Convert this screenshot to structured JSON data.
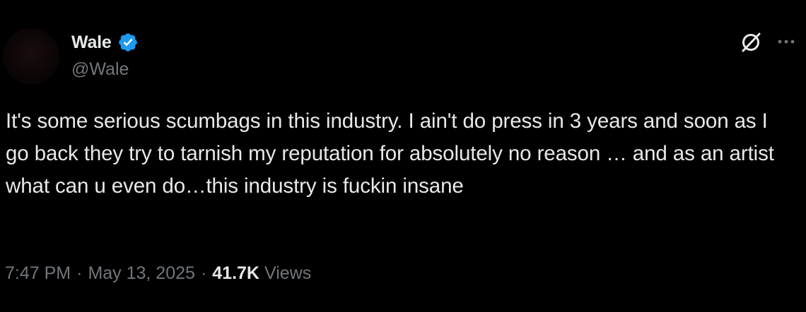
{
  "author": {
    "display_name": "Wale",
    "handle": "@Wale",
    "verified": true,
    "verified_color": "#1d9bf0"
  },
  "icons": {
    "verified": "verified-badge-icon",
    "grok": "grok-icon",
    "more": "more-options-icon"
  },
  "tweet": {
    "text": "It's some serious scumbags in this industry. I ain't do press in 3 years and soon as I go back they try to tarnish my reputation for absolutely no reason … and as an artist what can u even do…this industry is fuckin insane"
  },
  "meta": {
    "time": "7:47 PM",
    "separator": "·",
    "date": "May 13, 2025",
    "views_count": "41.7K",
    "views_label": "Views"
  },
  "colors": {
    "background": "#000000",
    "primary_text": "#e7e9ea",
    "secondary_text": "#71767b"
  }
}
